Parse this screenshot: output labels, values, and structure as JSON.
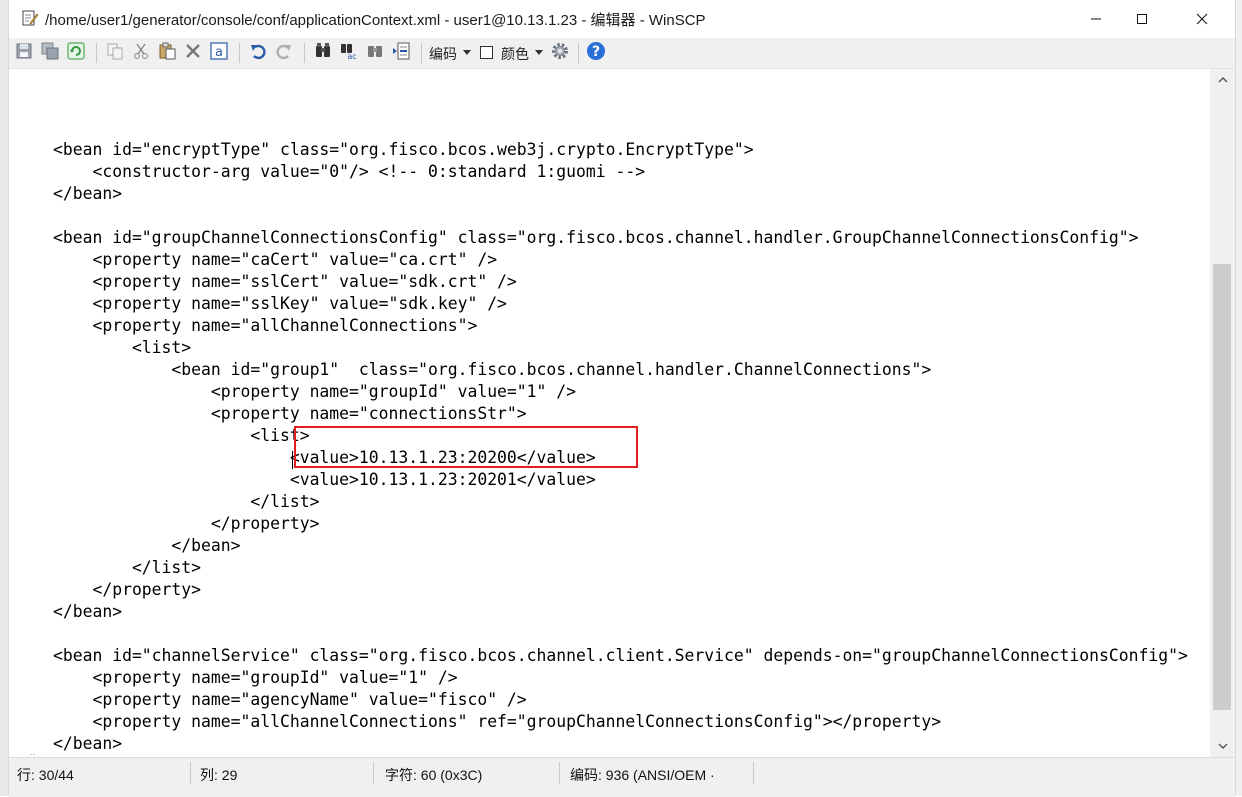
{
  "window": {
    "title": "/home/user1/generator/console/conf/applicationContext.xml - user1@10.13.1.23 - 编辑器 - WinSCP"
  },
  "toolbar": {
    "encoding_label": "编码",
    "color_label": "颜色"
  },
  "editor": {
    "lines": [
      "",
      "<bean id=\"encryptType\" class=\"org.fisco.bcos.web3j.crypto.EncryptType\">",
      "    <constructor-arg value=\"0\"/> <!-- 0:standard 1:guomi -->",
      "</bean>",
      "",
      "<bean id=\"groupChannelConnectionsConfig\" class=\"org.fisco.bcos.channel.handler.GroupChannelConnectionsConfig\">",
      "    <property name=\"caCert\" value=\"ca.crt\" />",
      "    <property name=\"sslCert\" value=\"sdk.crt\" />",
      "    <property name=\"sslKey\" value=\"sdk.key\" />",
      "    <property name=\"allChannelConnections\">",
      "        <list>",
      "            <bean id=\"group1\"  class=\"org.fisco.bcos.channel.handler.ChannelConnections\">",
      "                <property name=\"groupId\" value=\"1\" />",
      "                <property name=\"connectionsStr\">",
      "                    <list>",
      "                        <value>10.13.1.23:20200</value>",
      "                        <value>10.13.1.23:20201</value>",
      "                    </list>",
      "                </property>",
      "            </bean>",
      "        </list>",
      "    </property>",
      "</bean>",
      "",
      "<bean id=\"channelService\" class=\"org.fisco.bcos.channel.client.Service\" depends-on=\"groupChannelConnectionsConfig\">",
      "    <property name=\"groupId\" value=\"1\" />",
      "    <property name=\"agencyName\" value=\"fisco\" />",
      "    <property name=\"allChannelConnections\" ref=\"groupChannelConnectionsConfig\"></property>",
      "</bean>"
    ]
  },
  "statusbar": {
    "line": "行: 30/44",
    "column": "列: 29",
    "char": "字符: 60 (0x3C)",
    "encoding": "编码: 936   (ANSI/OEM ·"
  },
  "colors": {
    "highlight_box": "#e02020",
    "help_icon": "#2b6fd6",
    "refresh_icon": "#2e9a3a"
  },
  "icons": [
    "edit-file-icon",
    "save-icon",
    "save-all-icon",
    "reload-icon",
    "copy-icon",
    "cut-icon",
    "paste-icon",
    "delete-icon",
    "select-all-icon",
    "undo-icon",
    "redo-icon",
    "find-icon",
    "replace-icon",
    "find-next-icon",
    "goto-line-icon",
    "settings-icon",
    "help-icon"
  ]
}
